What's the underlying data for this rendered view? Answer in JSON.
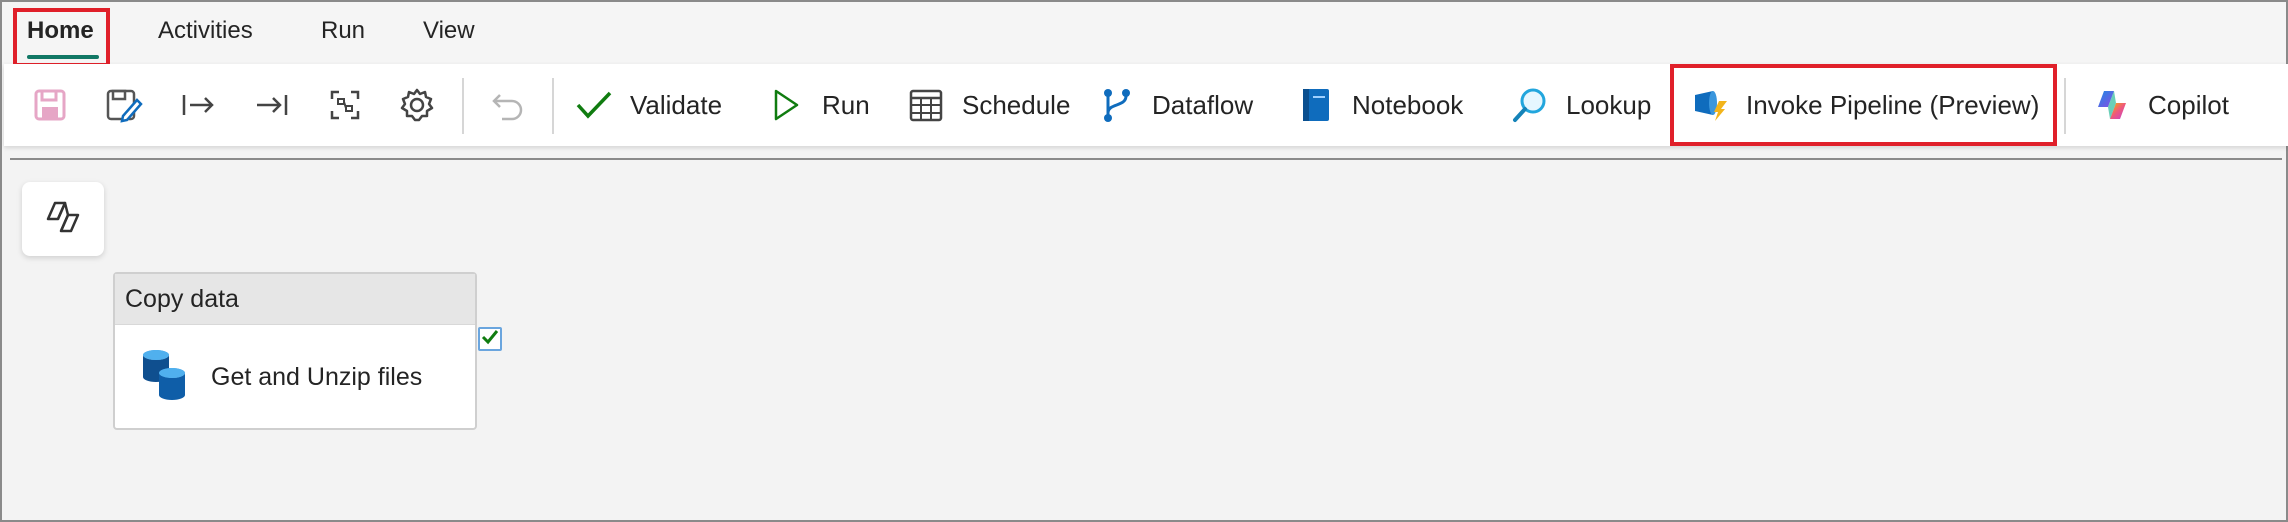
{
  "tabs": [
    {
      "label": "Home",
      "active": true
    },
    {
      "label": "Activities",
      "active": false
    },
    {
      "label": "Run",
      "active": false
    },
    {
      "label": "View",
      "active": false
    }
  ],
  "toolbar": {
    "icons": [
      "save-icon",
      "save-as-icon",
      "move-right-icon",
      "move-to-end-icon",
      "fit-view-icon",
      "settings-icon",
      "undo-icon"
    ],
    "buttons": [
      {
        "label": "Validate",
        "icon": "checkmark-icon"
      },
      {
        "label": "Run",
        "icon": "play-icon"
      },
      {
        "label": "Schedule",
        "icon": "calendar-icon"
      },
      {
        "label": "Dataflow",
        "icon": "dataflow-icon"
      },
      {
        "label": "Notebook",
        "icon": "notebook-icon"
      },
      {
        "label": "Lookup",
        "icon": "lookup-icon"
      },
      {
        "label": "Invoke Pipeline (Preview)",
        "icon": "invoke-pipeline-icon"
      },
      {
        "label": "Copilot",
        "icon": "copilot-icon"
      }
    ]
  },
  "canvas": {
    "activity": {
      "type_label": "Copy data",
      "name": "Get and Unzip files",
      "icon": "database-icon"
    }
  },
  "colors": {
    "accent": "#117865",
    "highlight": "#e0202a",
    "validate_green": "#107c10",
    "icon_blue": "#0f6cbd"
  }
}
